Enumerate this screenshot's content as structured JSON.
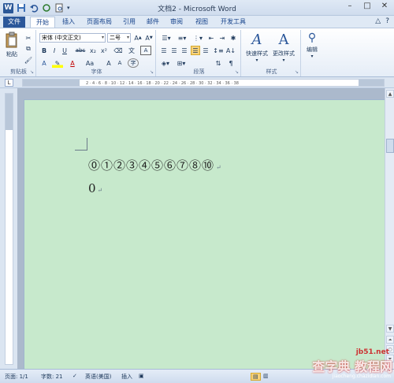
{
  "window": {
    "title": "文档2 - Microsoft Word",
    "app_icon": "W",
    "buttons": [
      "–",
      "□",
      "✕"
    ]
  },
  "tabs": {
    "file": "文件",
    "items": [
      "开始",
      "插入",
      "页面布局",
      "引用",
      "邮件",
      "审阅",
      "视图",
      "开发工具"
    ],
    "active": "开始"
  },
  "ribbon": {
    "clipboard": {
      "label": "剪贴板",
      "paste": "粘贴"
    },
    "font": {
      "label": "字体",
      "font_name": "宋体 (中文正文)",
      "font_size": "二号",
      "buttons": [
        "B",
        "I",
        "U",
        "abc",
        "x₂",
        "x²",
        "A",
        "A",
        "Aa",
        "A",
        "A"
      ]
    },
    "paragraph": {
      "label": "段落"
    },
    "styles": {
      "label": "样式",
      "quick_styles": "快速样式",
      "change_styles": "更改样式"
    },
    "editing": {
      "label": "编辑"
    }
  },
  "document": {
    "line1": "⓪①②③④⑤⑥⑦⑧⑩",
    "line2": "0",
    "para_mark": "↵"
  },
  "status": {
    "page": "页面: 1/1",
    "words": "字数: 21",
    "language": "英语(美国)",
    "mode": "插入"
  },
  "watermark": {
    "main": "查字典 教程网",
    "site": "jb51.net",
    "url": "jiaocheng.chazidian.com"
  }
}
